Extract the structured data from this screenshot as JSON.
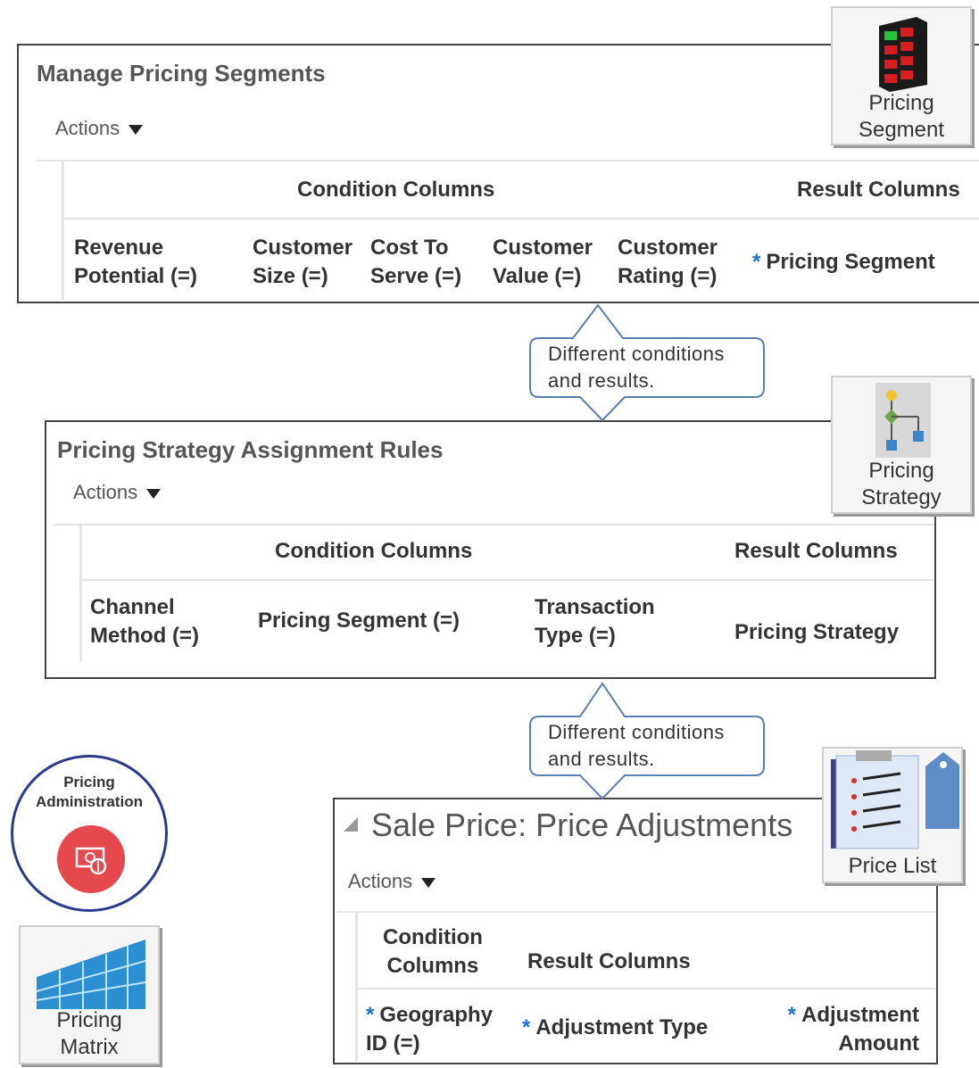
{
  "segments_panel": {
    "title": "Manage Pricing Segments",
    "actions_label": "Actions",
    "condition_header": "Condition Columns",
    "result_header": "Result Columns",
    "columns": {
      "c1_l1": "Revenue",
      "c1_l2": "Potential (=)",
      "c2_l1": "Customer",
      "c2_l2": "Size (=)",
      "c3_l1": "Cost To",
      "c3_l2": "Serve (=)",
      "c4_l1": "Customer",
      "c4_l2": "Value (=)",
      "c5_l1": "Customer",
      "c5_l2": "Rating (=)",
      "result": "Pricing Segment"
    }
  },
  "strategy_panel": {
    "title": "Pricing Strategy Assignment Rules",
    "actions_label": "Actions",
    "condition_header": "Condition Columns",
    "result_header": "Result Columns",
    "columns": {
      "c1_l1": "Channel",
      "c1_l2": "Method (=)",
      "c2": "Pricing Segment (=)",
      "c3_l1": "Transaction",
      "c3_l2": "Type (=)",
      "result": "Pricing Strategy"
    }
  },
  "adjust_panel": {
    "title": "Sale Price: Price Adjustments",
    "actions_label": "Actions",
    "condition_header_l1": "Condition",
    "condition_header_l2": "Columns",
    "result_header": "Result Columns",
    "columns": {
      "c1_l1": "Geography",
      "c1_l2": "ID (=)",
      "c2": "Adjustment Type",
      "c3_l1": "Adjustment",
      "c3_l2": "Amount"
    }
  },
  "callouts": [
    {
      "line1": "Different conditions",
      "line2": "and results."
    },
    {
      "line1": "Different conditions",
      "line2": "and results."
    }
  ],
  "icons": {
    "pricing_segment": {
      "line1": "Pricing",
      "line2": "Segment"
    },
    "pricing_strategy": {
      "line1": "Pricing",
      "line2": "Strategy"
    },
    "price_list": {
      "line1": "Price List"
    },
    "pricing_matrix": {
      "line1": "Pricing",
      "line2": "Matrix"
    },
    "pricing_admin": {
      "line1": "Pricing",
      "line2": "Administration"
    }
  },
  "colors": {
    "required_star": "#1f6fd1",
    "admin_badge": "#e5484d",
    "admin_ring": "#2b3a8c"
  }
}
